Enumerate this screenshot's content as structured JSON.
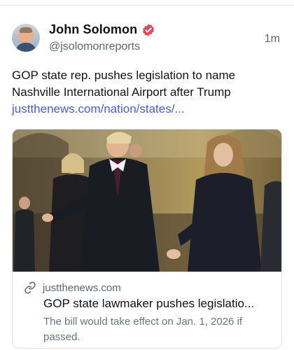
{
  "post": {
    "author_name": "John Solomon",
    "handle": "@jsolomonreports",
    "time": "1m",
    "text": "GOP state rep. pushes legislation to name Nashville International Airport after Trump",
    "link_text": "justthenews.com/nation/states/..."
  },
  "link_card": {
    "domain": "justthenews.com",
    "title": "GOP state lawmaker pushes legislatio...",
    "description": "The bill would take effect on Jan. 1, 2026 if passed."
  },
  "icons": {
    "verified": "verified-badge-icon",
    "link": "link-icon"
  },
  "colors": {
    "verified_badge": "#e0475d",
    "link": "#4a5bd6",
    "secondary_text": "#5b6670"
  }
}
